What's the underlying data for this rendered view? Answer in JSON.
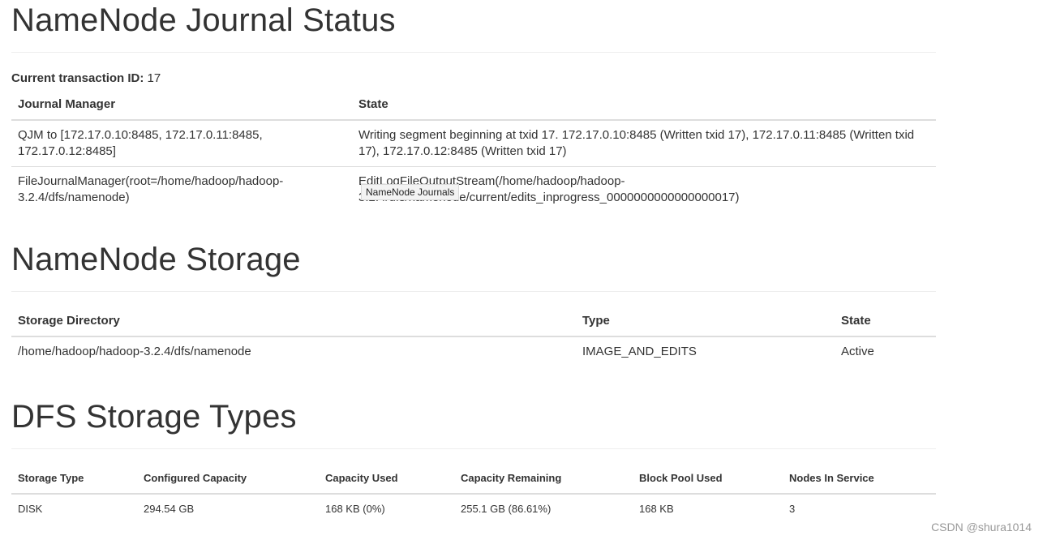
{
  "journal": {
    "title": "NameNode Journal Status",
    "current_txid_label": "Current transaction ID:",
    "current_txid_value": "17",
    "columns": [
      "Journal Manager",
      "State"
    ],
    "rows": [
      {
        "manager": "QJM to [172.17.0.10:8485, 172.17.0.11:8485, 172.17.0.12:8485]",
        "state": "Writing segment beginning at txid 17. 172.17.0.10:8485 (Written txid 17), 172.17.0.11:8485 (Written txid 17), 172.17.0.12:8485 (Written txid 17)"
      },
      {
        "manager": "FileJournalManager(root=/home/hadoop/hadoop-3.2.4/dfs/namenode)",
        "state": "EditLogFileOutputStream(/home/hadoop/hadoop-3.2.4/dfs/namenode/current/edits_inprogress_0000000000000000017)"
      }
    ],
    "tooltip": "NameNode Journals"
  },
  "storage": {
    "title": "NameNode Storage",
    "columns": [
      "Storage Directory",
      "Type",
      "State"
    ],
    "rows": [
      {
        "directory": "/home/hadoop/hadoop-3.2.4/dfs/namenode",
        "type": "IMAGE_AND_EDITS",
        "state": "Active"
      }
    ]
  },
  "storage_types": {
    "title": "DFS Storage Types",
    "columns": [
      "Storage Type",
      "Configured Capacity",
      "Capacity Used",
      "Capacity Remaining",
      "Block Pool Used",
      "Nodes In Service"
    ],
    "rows": [
      {
        "storage_type": "DISK",
        "configured_capacity": "294.54 GB",
        "capacity_used": "168 KB (0%)",
        "capacity_remaining": "255.1 GB (86.61%)",
        "block_pool_used": "168 KB",
        "nodes_in_service": "3"
      }
    ]
  },
  "watermark": "CSDN @shura1014"
}
